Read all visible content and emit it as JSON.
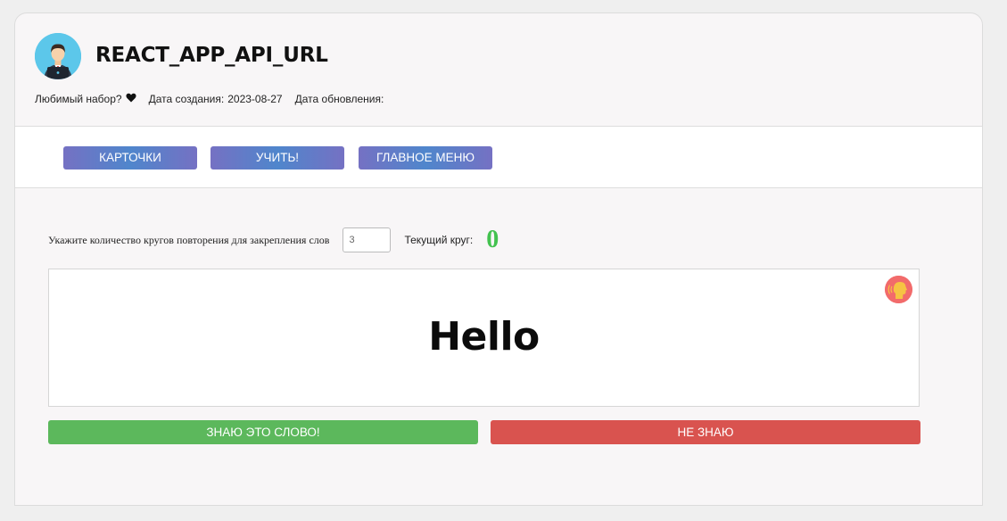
{
  "set": {
    "title": "REACT_APP_API_URL",
    "favorite_label": "Любимый набор?",
    "favorite_icon": "heart-icon",
    "created_label": "Дата создания:",
    "created_value": "2023-08-27",
    "updated_label": "Дата обновления:",
    "updated_value": ""
  },
  "nav": {
    "cards_label": "КАРТОЧКИ",
    "learn_label": "УЧИТЬ!",
    "main_menu_label": "ГЛАВНОЕ МЕНЮ"
  },
  "settings": {
    "rounds_label": "Укажите количество кругов повторения для закрепления слов",
    "rounds_value": "3",
    "current_round_label": "Текущий круг:",
    "current_round_value": "0"
  },
  "card": {
    "word": "Hello",
    "speak_icon": "speaking-head-icon"
  },
  "actions": {
    "know_label": "ЗНАЮ ЭТО СЛОВО!",
    "dont_know_label": "НЕ ЗНАЮ"
  },
  "colors": {
    "page_bg": "#efefef",
    "panel_bg": "#f8f6f7",
    "nav_gradient_start": "#7571c3",
    "nav_gradient_mid": "#4f86cc",
    "round_counter": "#43c24f",
    "know_button": "#5cb85c",
    "dont_know_button": "#d9534f",
    "speak_button": "#f26b6b",
    "avatar_bg": "#5cc7ea"
  }
}
